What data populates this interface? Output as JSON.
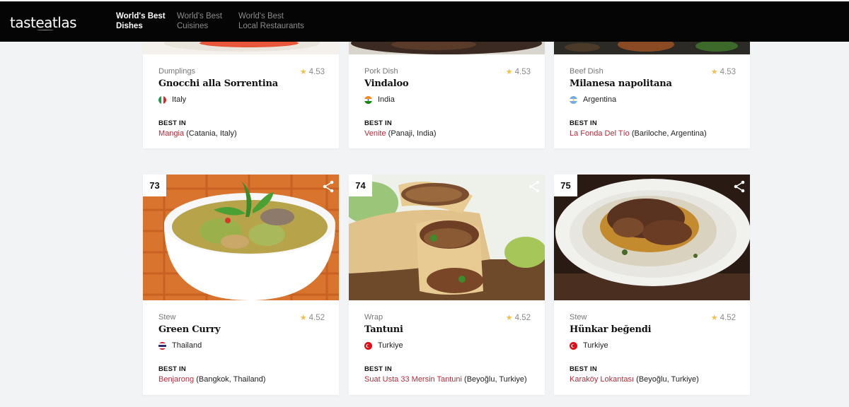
{
  "nav": {
    "logo": "tasteatlas",
    "items": [
      {
        "line1": "World's Best",
        "line2": "Dishes"
      },
      {
        "line1": "World's Best",
        "line2": "Cuisines"
      },
      {
        "line1": "World's Best",
        "line2": "Local Restaurants"
      }
    ]
  },
  "cards": [
    {
      "category": "Dumplings",
      "rating": "4.53",
      "name": "Gnocchi alla Sorrentina",
      "country": "Italy",
      "best_in": "BEST IN",
      "restaurant": "Mangia",
      "location": " (Catania, Italy)"
    },
    {
      "category": "Pork Dish",
      "rating": "4.53",
      "name": "Vindaloo",
      "country": "India",
      "best_in": "BEST IN",
      "restaurant": "Venite",
      "location": " (Panaji, India)"
    },
    {
      "category": "Beef Dish",
      "rating": "4.53",
      "name": "Milanesa napolitana",
      "country": "Argentina",
      "best_in": "BEST IN",
      "restaurant": "La Fonda Del Tío",
      "location": " (Bariloche, Argentina)"
    },
    {
      "rank": "73",
      "category": "Stew",
      "rating": "4.52",
      "name": "Green Curry",
      "country": "Thailand",
      "best_in": "BEST IN",
      "restaurant": "Benjarong",
      "location": " (Bangkok, Thailand)"
    },
    {
      "rank": "74",
      "category": "Wrap",
      "rating": "4.52",
      "name": "Tantuni",
      "country": "Turkiye",
      "best_in": "BEST IN",
      "restaurant": "Suat Usta 33 Mersin Tantuni",
      "location": " (Beyoğlu, Turkiye)"
    },
    {
      "rank": "75",
      "category": "Stew",
      "rating": "4.52",
      "name": "Hünkar beğendi",
      "country": "Turkiye",
      "best_in": "BEST IN",
      "restaurant": "Karaköy Lokantası",
      "location": " (Beyoğlu, Turkiye)"
    }
  ]
}
